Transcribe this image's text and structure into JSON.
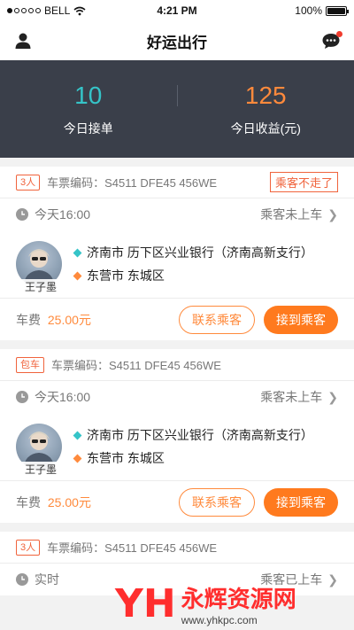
{
  "status_bar": {
    "carrier": "BELL",
    "time": "4:21 PM",
    "battery": "100%",
    "battery_level": 1.0
  },
  "nav": {
    "title": "好运出行",
    "profile_icon": "person-icon",
    "message_icon": "chat-bubble-icon"
  },
  "stats": [
    {
      "value": "10",
      "label": "今日接单",
      "color": "#35c4c8"
    },
    {
      "value": "125",
      "label": "今日收益(元)",
      "color": "#ff8a3c"
    }
  ],
  "orders": [
    {
      "tag": "3人",
      "ticket": "车票编码：S4511 DFE45 456WE",
      "warn_button": "乘客不走了",
      "time": "今天16:00",
      "state": "乘客未上车",
      "passenger": "王子墨",
      "from": "济南市 历下区兴业银行（济南高新支行）",
      "to": "东营市 东城区",
      "fare_label": "车费",
      "fare_amount": "25.00",
      "fare_unit": "元",
      "contact_button": "联系乘客",
      "pickup_button": "接到乘客"
    },
    {
      "tag": "包车",
      "ticket": "车票编码：S4511 DFE45 456WE",
      "time": "今天16:00",
      "state": "乘客未上车",
      "passenger": "王子墨",
      "from": "济南市 历下区兴业银行（济南高新支行）",
      "to": "东营市 东城区",
      "fare_label": "车费",
      "fare_amount": "25.00",
      "fare_unit": "元",
      "contact_button": "联系乘客",
      "pickup_button": "接到乘客"
    },
    {
      "tag": "3人",
      "ticket": "车票编码：S4511 DFE45 456WE",
      "time": "实时",
      "state": "乘客已上车"
    }
  ],
  "watermark": {
    "logo": "YH",
    "text": "永辉资源网",
    "url": "www.yhkpc.com"
  }
}
